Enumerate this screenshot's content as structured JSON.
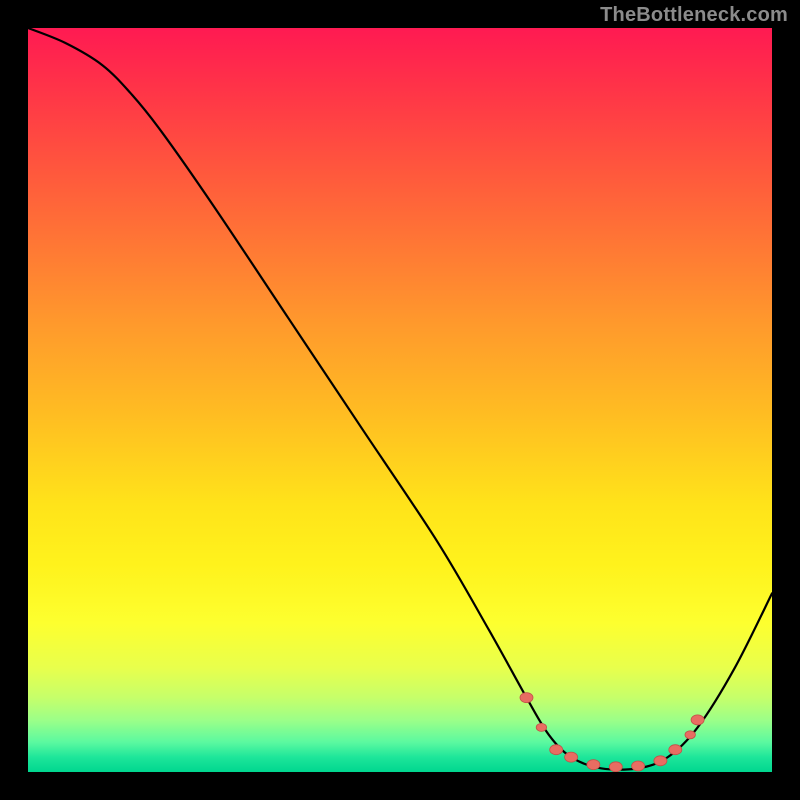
{
  "attribution": "TheBottleneck.com",
  "colors": {
    "curve_stroke": "#000000",
    "marker_fill": "#e86d62",
    "marker_stroke": "#c25148"
  },
  "chart_data": {
    "type": "line",
    "title": "",
    "xlabel": "",
    "ylabel": "",
    "xlim": [
      0,
      100
    ],
    "ylim": [
      0,
      100
    ],
    "curve": [
      {
        "x": 0,
        "y": 100
      },
      {
        "x": 5,
        "y": 98
      },
      {
        "x": 10,
        "y": 95
      },
      {
        "x": 14,
        "y": 91
      },
      {
        "x": 18,
        "y": 86
      },
      {
        "x": 25,
        "y": 76
      },
      {
        "x": 35,
        "y": 61
      },
      {
        "x": 45,
        "y": 46
      },
      {
        "x": 55,
        "y": 31
      },
      {
        "x": 62,
        "y": 19
      },
      {
        "x": 67,
        "y": 10
      },
      {
        "x": 70,
        "y": 5
      },
      {
        "x": 73,
        "y": 2
      },
      {
        "x": 77,
        "y": 0.5
      },
      {
        "x": 82,
        "y": 0.5
      },
      {
        "x": 86,
        "y": 2
      },
      {
        "x": 90,
        "y": 6
      },
      {
        "x": 95,
        "y": 14
      },
      {
        "x": 100,
        "y": 24
      }
    ],
    "markers": [
      {
        "x": 67,
        "y": 10,
        "r": 5
      },
      {
        "x": 69,
        "y": 6,
        "r": 4
      },
      {
        "x": 71,
        "y": 3,
        "r": 5
      },
      {
        "x": 73,
        "y": 2,
        "r": 5
      },
      {
        "x": 76,
        "y": 1,
        "r": 5
      },
      {
        "x": 79,
        "y": 0.7,
        "r": 5
      },
      {
        "x": 82,
        "y": 0.8,
        "r": 5
      },
      {
        "x": 85,
        "y": 1.5,
        "r": 5
      },
      {
        "x": 87,
        "y": 3,
        "r": 5
      },
      {
        "x": 89,
        "y": 5,
        "r": 4
      },
      {
        "x": 90,
        "y": 7,
        "r": 5
      }
    ]
  }
}
